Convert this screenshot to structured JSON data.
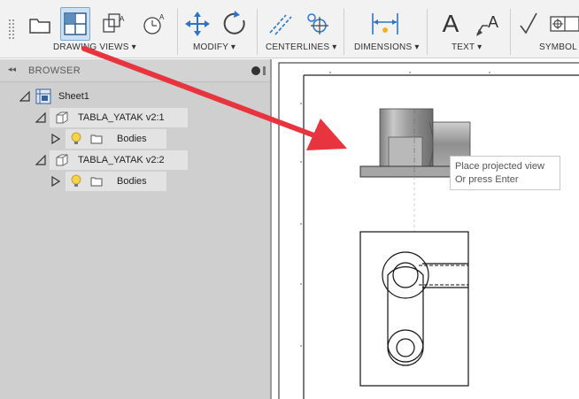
{
  "toolbar": {
    "groups": {
      "drawing_views": "DRAWING VIEWS",
      "modify": "MODIFY",
      "centerlines": "CENTERLINES",
      "dimensions": "DIMENSIONS",
      "text": "TEXT",
      "symbols": "SYMBOL"
    },
    "text_glyph": "A"
  },
  "browser": {
    "title": "BROWSER",
    "sheet": "Sheet1",
    "components": [
      {
        "label": "TABLA_YATAK v2:1",
        "child": "Bodies"
      },
      {
        "label": "TABLA_YATAK v2:2",
        "child": "Bodies"
      }
    ]
  },
  "tooltip": {
    "line1": "Place projected view",
    "line2": "Or press Enter"
  },
  "colors": {
    "arrow": "#e8343f",
    "active_tool": "#cbe1f3",
    "tool_icon_blue": "#2c74c8"
  }
}
